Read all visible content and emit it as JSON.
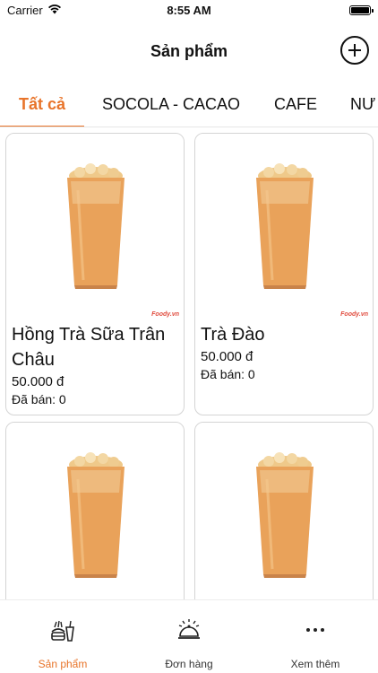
{
  "status_bar": {
    "carrier": "Carrier",
    "time": "8:55 AM"
  },
  "header": {
    "title": "Sản phẩm",
    "add_icon": "plus-circle-icon"
  },
  "tabs": [
    {
      "label": "Tất cả",
      "active": true
    },
    {
      "label": "SOCOLA - CACAO",
      "active": false
    },
    {
      "label": "CAFE",
      "active": false
    },
    {
      "label": "NƯ",
      "active": false
    }
  ],
  "products": [
    {
      "name": "Hồng Trà Sữa Trân Châu",
      "price": "50.000 đ",
      "sold": "Đã bán: 0",
      "watermark": "Foody.vn"
    },
    {
      "name": "Trà Đào",
      "price": "50.000 đ",
      "sold": "Đã bán: 0",
      "watermark": "Foody.vn"
    },
    {
      "name": "",
      "price": "",
      "sold": "",
      "watermark": ""
    },
    {
      "name": "",
      "price": "",
      "sold": "",
      "watermark": ""
    }
  ],
  "tab_bar": [
    {
      "label": "Sản phẩm",
      "icon": "food-icon",
      "active": true
    },
    {
      "label": "Đơn hàng",
      "icon": "service-bell-icon",
      "active": false
    },
    {
      "label": "Xem thêm",
      "icon": "more-dots-icon",
      "active": false
    }
  ],
  "colors": {
    "accent": "#e8742a",
    "text": "#111111",
    "border": "#d4d4d4"
  }
}
